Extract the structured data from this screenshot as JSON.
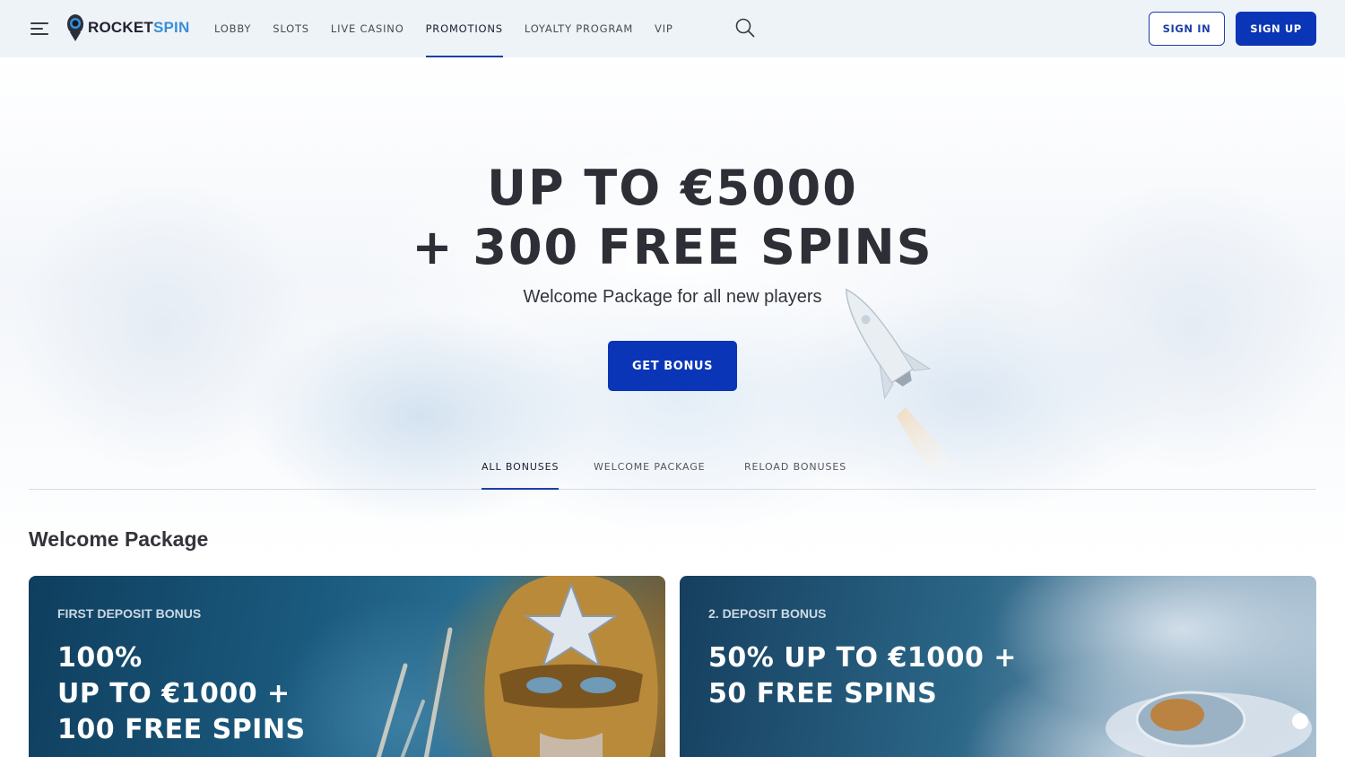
{
  "header": {
    "logo": {
      "part1": "ROCKET",
      "part2": "SPIN"
    },
    "nav": [
      {
        "label": "LOBBY",
        "active": false
      },
      {
        "label": "SLOTS",
        "active": false
      },
      {
        "label": "LIVE CASINO",
        "active": false
      },
      {
        "label": "PROMOTIONS",
        "active": true
      },
      {
        "label": "LOYALTY PROGRAM",
        "active": false
      },
      {
        "label": "VIP",
        "active": false
      }
    ],
    "sign_in": "SIGN IN",
    "sign_up": "SIGN UP"
  },
  "hero": {
    "title_line1": "UP TO €5000",
    "title_line2": "+ 300 FREE SPINS",
    "subtitle": "Welcome Package for all new players",
    "cta": "GET BONUS"
  },
  "tabs": [
    {
      "label": "ALL BONUSES",
      "active": true
    },
    {
      "label": "WELCOME PACKAGE",
      "active": false
    },
    {
      "label": "RELOAD BONUSES",
      "active": false
    }
  ],
  "section": {
    "title": "Welcome Package",
    "cards": [
      {
        "label": "FIRST DEPOSIT BONUS",
        "headline_lines": [
          "100%",
          "UP TO €1000 +",
          "100 FREE SPINS"
        ]
      },
      {
        "label": "2. DEPOSIT BONUS",
        "headline_lines": [
          "50% UP TO €1000 +",
          "50 FREE SPINS"
        ]
      }
    ]
  },
  "colors": {
    "brand_blue": "#0b35b7",
    "accent_blue": "#3a8fd6",
    "header_bg": "#eef3f8"
  },
  "icons": [
    "menu-icon",
    "rocket-logo-icon",
    "search-icon"
  ]
}
